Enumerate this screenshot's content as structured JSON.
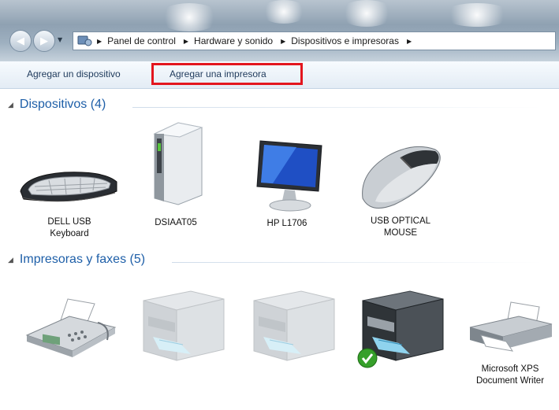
{
  "breadcrumb": [
    "Panel de control",
    "Hardware y sonido",
    "Dispositivos e impresoras"
  ],
  "toolbar": {
    "add_device": "Agregar un dispositivo",
    "add_printer": "Agregar una impresora"
  },
  "groups": {
    "devices": {
      "header": "Dispositivos (4)",
      "items": [
        {
          "label": "DELL USB\nKeyboard",
          "icon": "keyboard-icon"
        },
        {
          "label": "DSIAAT05",
          "icon": "computer-tower-icon"
        },
        {
          "label": "HP L1706",
          "icon": "monitor-icon"
        },
        {
          "label": "USB OPTICAL\nMOUSE",
          "icon": "mouse-icon"
        }
      ]
    },
    "printers": {
      "header": "Impresoras y faxes (5)",
      "items": [
        {
          "label": "",
          "icon": "fax-icon"
        },
        {
          "label": "",
          "icon": "multifunction-printer-icon"
        },
        {
          "label": "",
          "icon": "multifunction-printer-icon"
        },
        {
          "label": "",
          "icon": "default-multifunction-printer-icon"
        },
        {
          "label": "Microsoft XPS\nDocument Writer",
          "icon": "printer-icon"
        }
      ]
    }
  },
  "colors": {
    "highlight": "#e3161e",
    "group_header": "#1e5fa8",
    "default_check": "#36a02a"
  }
}
